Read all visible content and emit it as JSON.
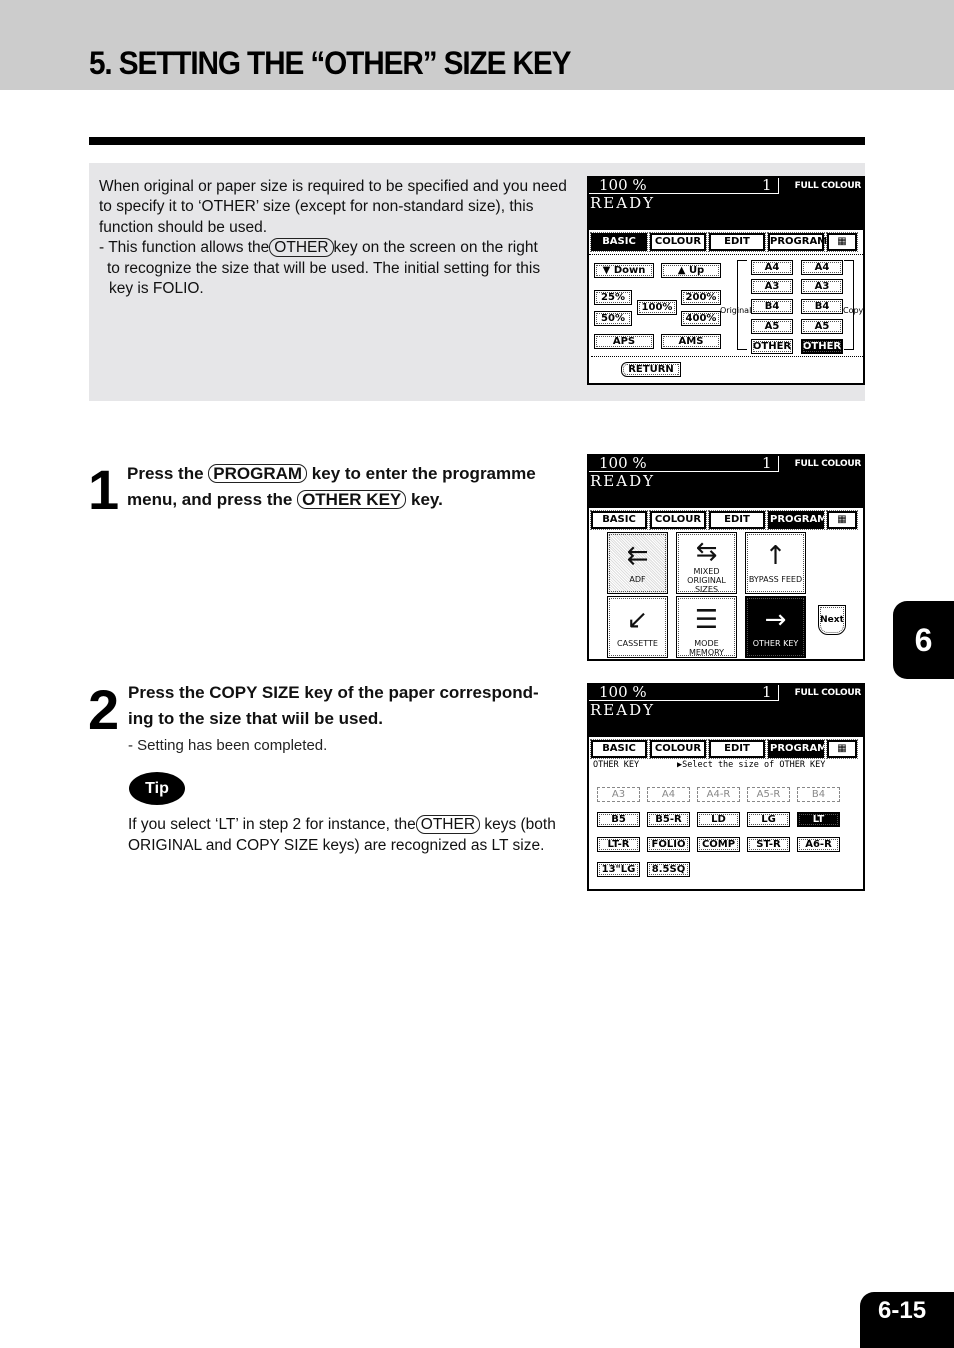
{
  "page": {
    "title": "5. SETTING THE “OTHER” SIZE KEY",
    "chapter_tab": "6",
    "page_number": "6-15"
  },
  "intro": {
    "para1": "When original or paper size is required to be specified and you need to specify it to ‘OTHER’ size (except for non-standard size), this function should be used.",
    "bullet_prefix": "- This function allows the",
    "bullet_key": "OTHER",
    "bullet_suffix_1": "key on the screen on the right",
    "bullet_line2": "to recognize the size that will be used.  The initial setting for this",
    "bullet_line3": "key is FOLIO."
  },
  "steps": [
    {
      "number": "1",
      "text_a": "Press the",
      "key_a": "PROGRAM",
      "text_b": "key to enter the programme",
      "text_c": "menu, and press the",
      "key_b": "OTHER KEY",
      "text_d": "key."
    },
    {
      "number": "2",
      "line1": "Press the  COPY SIZE  key of the paper correspond-",
      "line2": "ing to the size that wiil be used.",
      "sub": "-  Setting has been completed."
    }
  ],
  "tip": {
    "badge": "Tip",
    "text_a": "If you select ‘LT’ in step 2 for instance, the",
    "key": "OTHER",
    "text_b": "keys (both",
    "line2": "ORIGINAL and COPY SIZE keys) are recognized as LT size."
  },
  "lcd_common": {
    "zoom": "100  %",
    "quantity": "1",
    "mode": "FULL COLOUR",
    "status": "READY",
    "tabs": [
      "BASIC",
      "COLOUR",
      "EDIT",
      "PROGRAM",
      "▦"
    ]
  },
  "screen1": {
    "active_tab": "BASIC",
    "down": "▼ Down",
    "up": "▲ Up",
    "zoom_presets": [
      "25%",
      "50%",
      "100%",
      "200%",
      "400%"
    ],
    "aps": "APS",
    "ams": "AMS",
    "original_label": "Original",
    "copy_label": "Copy",
    "original_sizes": [
      "A4",
      "A3",
      "B4",
      "A5",
      "OTHER"
    ],
    "copy_sizes": [
      "A4",
      "A3",
      "B4",
      "A5",
      "OTHER"
    ],
    "selected_copy": "OTHER",
    "return": "RETURN"
  },
  "screen2": {
    "active_tab": "PROGRAM",
    "tiles": [
      {
        "label": "ADF",
        "icon": "adf-icon",
        "glyph": "⇇"
      },
      {
        "label": "MIXED ORIGINAL SIZES",
        "icon": "mixed-sizes-icon",
        "glyph": "⇆"
      },
      {
        "label": "BYPASS FEED",
        "icon": "bypass-feed-icon",
        "glyph": "↑"
      },
      {
        "label": "CASSETTE",
        "icon": "cassette-icon",
        "glyph": "↙"
      },
      {
        "label": "MODE MEMORY",
        "icon": "mode-memory-icon",
        "glyph": "☰"
      },
      {
        "label": "OTHER KEY",
        "icon": "other-key-icon",
        "glyph": "→"
      }
    ],
    "next": "Next"
  },
  "screen3": {
    "active_tab": "PROGRAM",
    "title": "OTHER KEY",
    "prompt": "▶Select the size of OTHER KEY",
    "disabled_sizes": [
      "A3",
      "A4",
      "A4-R",
      "A5-R",
      "B4"
    ],
    "sizes_row2": [
      "B5",
      "B5-R",
      "LD",
      "LG",
      "LT"
    ],
    "sizes_row3": [
      "LT-R",
      "FOLIO",
      "COMP",
      "ST-R",
      "A6-R"
    ],
    "sizes_row4": [
      "13\"LG",
      "8.5SQ"
    ],
    "selected": "LT"
  }
}
